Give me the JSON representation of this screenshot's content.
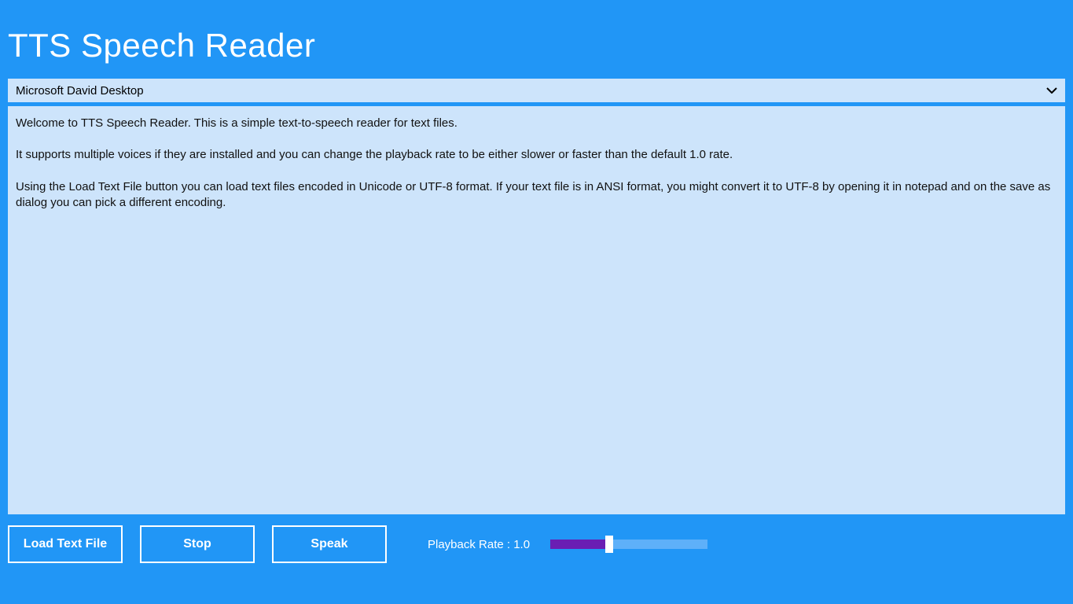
{
  "app": {
    "title": "TTS Speech Reader"
  },
  "voice_select": {
    "selected": "Microsoft David Desktop"
  },
  "content": {
    "p1": "Welcome to TTS Speech Reader.  This is a simple text-to-speech reader for text files.",
    "p2": "It supports multiple voices if they are installed and you can change the playback rate to be either slower or faster than the default 1.0 rate.",
    "p3": "Using the Load Text File button you can load text files encoded in Unicode or UTF-8 format.  If your text file is in ANSI format, you might convert it to UTF-8 by opening it in notepad and on the save as dialog you can pick a different encoding."
  },
  "controls": {
    "load_label": "Load Text File",
    "stop_label": "Stop",
    "speak_label": "Speak",
    "rate_label": "Playback Rate : 1.0",
    "rate_value": 1.0,
    "rate_min": 0.0,
    "rate_max": 3.0
  },
  "colors": {
    "background": "#2196f6",
    "panel": "#cde4fb",
    "slider_fill": "#6a1eb3",
    "slider_empty": "#5eb0f9"
  }
}
